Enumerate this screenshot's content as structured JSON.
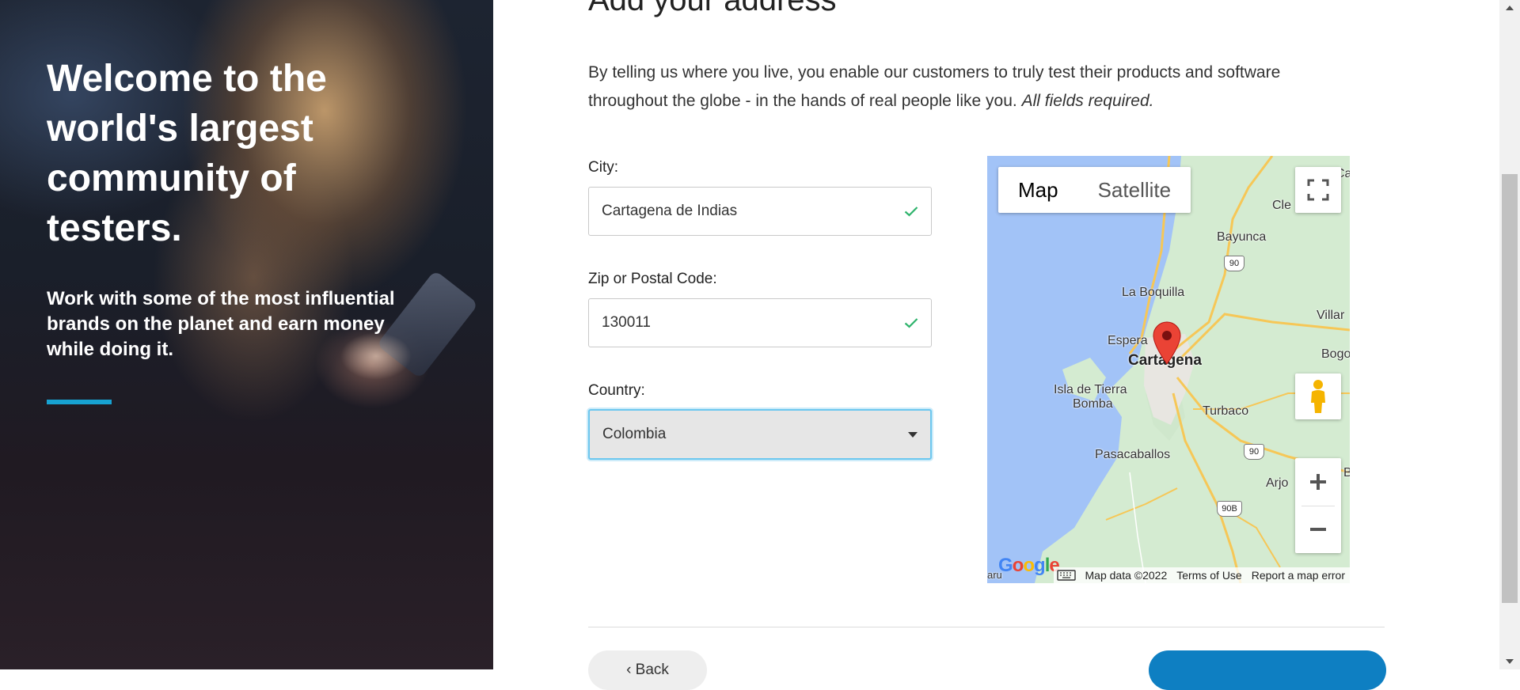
{
  "hero": {
    "title": "Welcome to the world's largest community of testers.",
    "subtitle": "Work with some of the most influential brands on the planet and earn money while doing it."
  },
  "form": {
    "heading": "Add your address",
    "intro": "By telling us where you live, you enable our customers to truly test their products and software throughout the globe - in the hands of real people like you.",
    "intro_emphasis": "All fields required.",
    "city": {
      "label": "City:",
      "value": "Cartagena de Indias",
      "valid": true
    },
    "zip": {
      "label": "Zip or Postal Code:",
      "value": "130011",
      "valid": true
    },
    "country": {
      "label": "Country:",
      "selected": "Colombia"
    }
  },
  "map": {
    "types": [
      "Map",
      "Satellite"
    ],
    "active_type": "Map",
    "labels": {
      "main_city": "Cartagena",
      "bayunca": "Bayunca",
      "la_boquilla": "La Boquilla",
      "esperanza": "Espera",
      "isla_line1": "Isla de Tierra",
      "isla_line2": "Bomba",
      "turbaco": "Turbaco",
      "pasacaballos": "Pasacaballos",
      "arjona": "Arjo",
      "villa": "Villar",
      "bogo": "Bogo",
      "clem": "Cle",
      "ca": "Ca",
      "b": "B",
      "baru": "aru"
    },
    "route_shields": [
      "90",
      "90",
      "90B"
    ],
    "google": "Google",
    "attribution": {
      "map_data": "Map data ©2022",
      "terms": "Terms of Use",
      "report": "Report a map error"
    }
  },
  "footer": {
    "back_label": "‹ Back"
  },
  "colors": {
    "accent": "#17a2d1",
    "primary_button": "#0e7fc2",
    "check": "#2db36b",
    "pin": "#ea4335"
  }
}
